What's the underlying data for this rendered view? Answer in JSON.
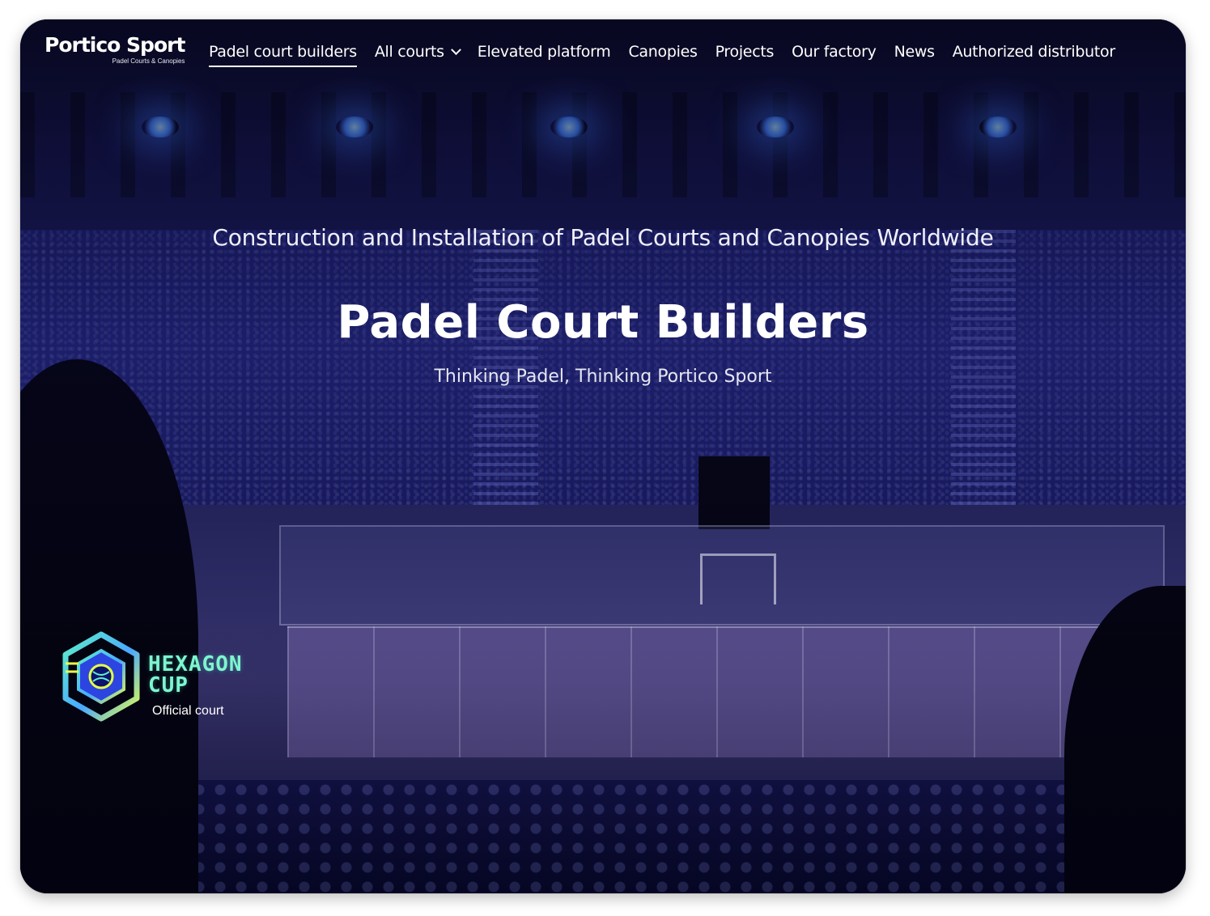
{
  "logo": {
    "name": "Portico Sport",
    "tagline": "Padel Courts & Canopies"
  },
  "nav": {
    "items": [
      {
        "label": "Padel court builders",
        "active": true
      },
      {
        "label": "All courts",
        "has_dropdown": true,
        "dropdown_icon": "chevron-down-icon"
      },
      {
        "label": "Elevated platform"
      },
      {
        "label": "Canopies"
      },
      {
        "label": "Projects"
      },
      {
        "label": "Our factory"
      },
      {
        "label": "News"
      },
      {
        "label": "Authorized distributor"
      }
    ]
  },
  "hero": {
    "tagline": "Construction and Installation of Padel Courts and Canopies Worldwide",
    "title": "Padel Court Builders",
    "subtitle": "Thinking Padel, Thinking Portico Sport",
    "background": "padel arena with blue stage lighting and crowd"
  },
  "badge": {
    "name_line1": "HEXAGON",
    "name_line2": "CUP",
    "caption": "Official court",
    "icon": "hexagon-cup-logo-icon",
    "colors": {
      "teal": "#5ef0c8",
      "blue": "#3a5cff",
      "yellow": "#e6ff4a"
    }
  },
  "colors": {
    "nav_text": "#ffffff",
    "overlay": "#120f3a"
  }
}
